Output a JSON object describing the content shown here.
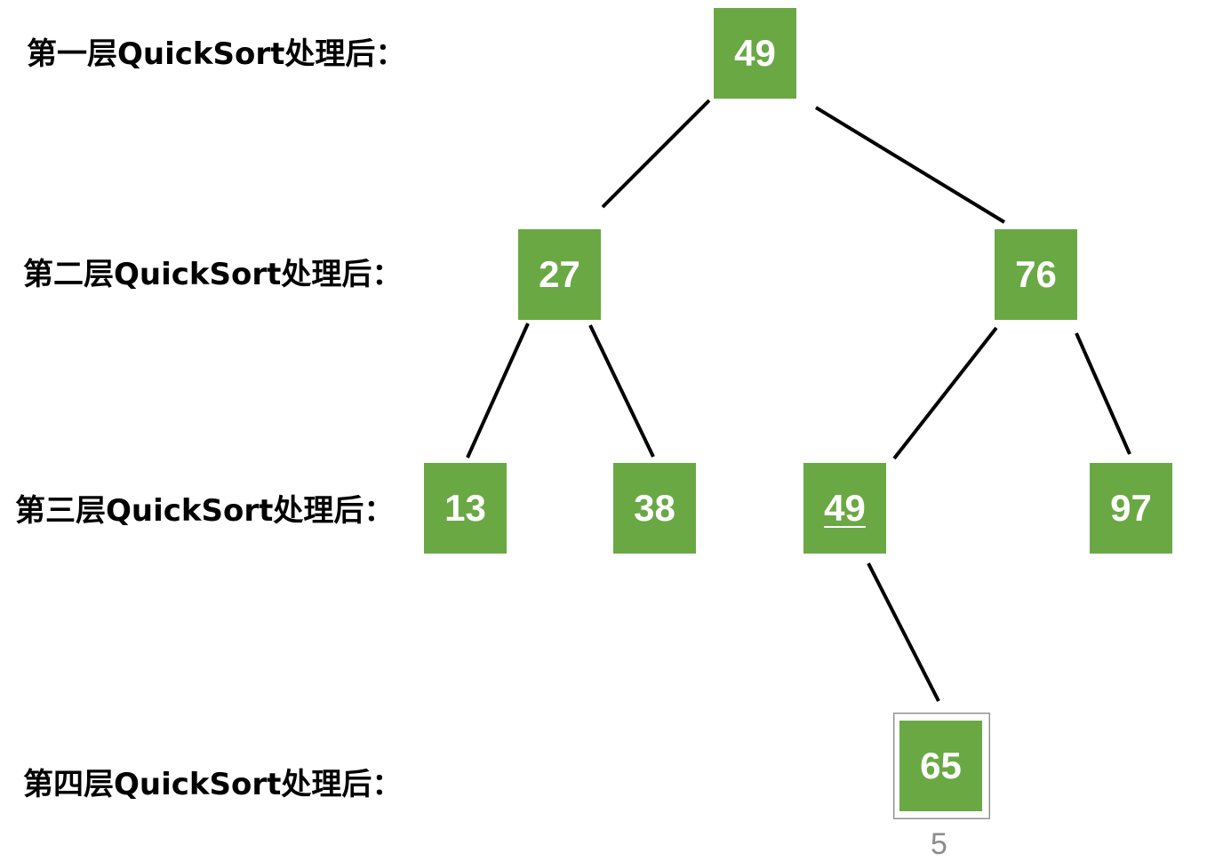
{
  "levels": [
    "第一层QuickSort处理后：",
    "第二层QuickSort处理后：",
    "第三层QuickSort处理后：",
    "第四层QuickSort处理后："
  ],
  "nodes": {
    "root": "49",
    "l2_left": "27",
    "l2_right": "76",
    "l3_a": "13",
    "l3_b": "38",
    "l3_c": "49",
    "l3_d": "97",
    "l4": "65"
  },
  "node_color": "#6aa844",
  "caption": "5"
}
